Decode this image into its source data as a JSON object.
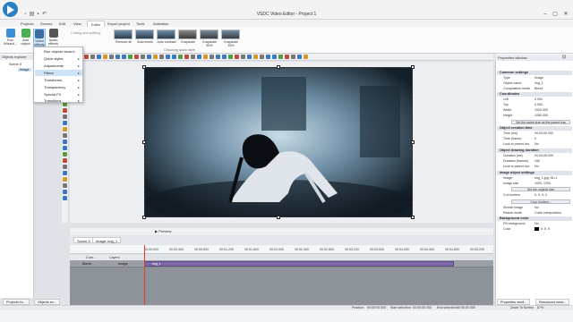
{
  "window": {
    "title": "VSDC Video Editor - Project 1",
    "controls": [
      "–",
      "▢",
      "✕"
    ]
  },
  "menu_tabs": [
    "Projects",
    "Scenes",
    "Edit",
    "View",
    "Editor",
    "Export project",
    "Tools",
    "Activation"
  ],
  "active_tab": "Editor",
  "ribbon": {
    "run_wizard": "Run Wizard...",
    "add_object": "Add object",
    "video_effects": "Video effects",
    "audio_effects": "Audio effects",
    "cutting_label": "Cutting and splitting",
    "effects": [
      "Remove all",
      "Auto levels",
      "Auto contrast",
      "Grayscale",
      "Grayscale 50%",
      "Grayscale 33%"
    ],
    "group_label": "Choosing quick style"
  },
  "video_effects_menu": {
    "items": [
      "Run objects wizard...",
      "Quick styles",
      "Adjustments",
      "Filters",
      "Transforms",
      "Transparency",
      "Special FX",
      "Transitions"
    ],
    "selected": "Filters"
  },
  "left_panel": {
    "title": "Objects explorer",
    "tree": [
      "Scene 0",
      "Image"
    ]
  },
  "timeline": {
    "tabs": [
      "Scene 0",
      "Image: img_1"
    ],
    "preview_label": "Preview",
    "ruler_ticks": [
      "00:00.000",
      "00:00.400",
      "00:00.800",
      "00:01.200",
      "00:01.600",
      "00:02.000",
      "00:02.400",
      "00:02.800",
      "00:03.200",
      "00:03.600",
      "00:04.000",
      "00:04.400",
      "00:04.800",
      "00:05.200"
    ],
    "headers": [
      "Com...",
      "Layers"
    ],
    "track_blend": "Blend",
    "track_name": "Image",
    "clip_name": "img_1"
  },
  "properties": {
    "title": "Properties window",
    "sections": {
      "common": "Common settings",
      "coordinates": "Coordinates",
      "creation": "Object creation time",
      "drawing": "Object drawing duration",
      "image_settings": "Image object settings",
      "background": "Background color"
    },
    "rows": {
      "type": [
        "Type",
        "Image"
      ],
      "object_name": [
        "Object name",
        "img_1"
      ],
      "composition": [
        "Composition mode",
        "Blend"
      ],
      "left": [
        "Left",
        "0.000"
      ],
      "top": [
        "Top",
        "0.000"
      ],
      "width": [
        "Width",
        "1920.000"
      ],
      "height": [
        "Height",
        "1080.000"
      ],
      "time_ms": [
        "Time (ms)",
        "00:00:00.000"
      ],
      "time_frame": [
        "Time (frame)",
        "0"
      ],
      "lock_creation": [
        "Lock to parent dur.",
        "No"
      ],
      "duration_ms": [
        "Duration (ms)",
        "00:00:05.000"
      ],
      "duration_frames": [
        "Duration (frames)",
        "150"
      ],
      "lock_duration": [
        "Lock to parent dur.",
        "No"
      ],
      "image": [
        "Image",
        "img_1.jpg; ID=1"
      ],
      "image_size": [
        "Image size",
        "1920; 1200"
      ],
      "cut_borders": [
        "Cut borders",
        "0; 0; 0; 0"
      ],
      "stretch": [
        "Stretch image",
        "No"
      ],
      "resize": [
        "Resize mode",
        "Cubic interpolation"
      ],
      "fill_bg": [
        "Fill background",
        "No"
      ],
      "color": [
        "Color",
        "0; 0; 0"
      ]
    },
    "buttons": {
      "same_size": "Set the same size as the parent has",
      "original_size": "Set the original size",
      "crop": "Crop borders..."
    }
  },
  "bottom_tabs": [
    "Projects ex...",
    "Objects ex..."
  ],
  "right_bottom_tabs": [
    "Properties wind...",
    "Resources wind..."
  ],
  "status": {
    "position_label": "Position:",
    "position": "00:00:00.000",
    "start_label": "Start selection:",
    "start": "00:00:00.000",
    "end_label": "End selection:",
    "end": "00:00:00.000",
    "zoom": "Zoom To Screen",
    "zoom_pct": "67%"
  },
  "colors": {
    "accent": "#2a7fc1",
    "clip": "#7f68a8",
    "playhead": "#e23b2c"
  }
}
